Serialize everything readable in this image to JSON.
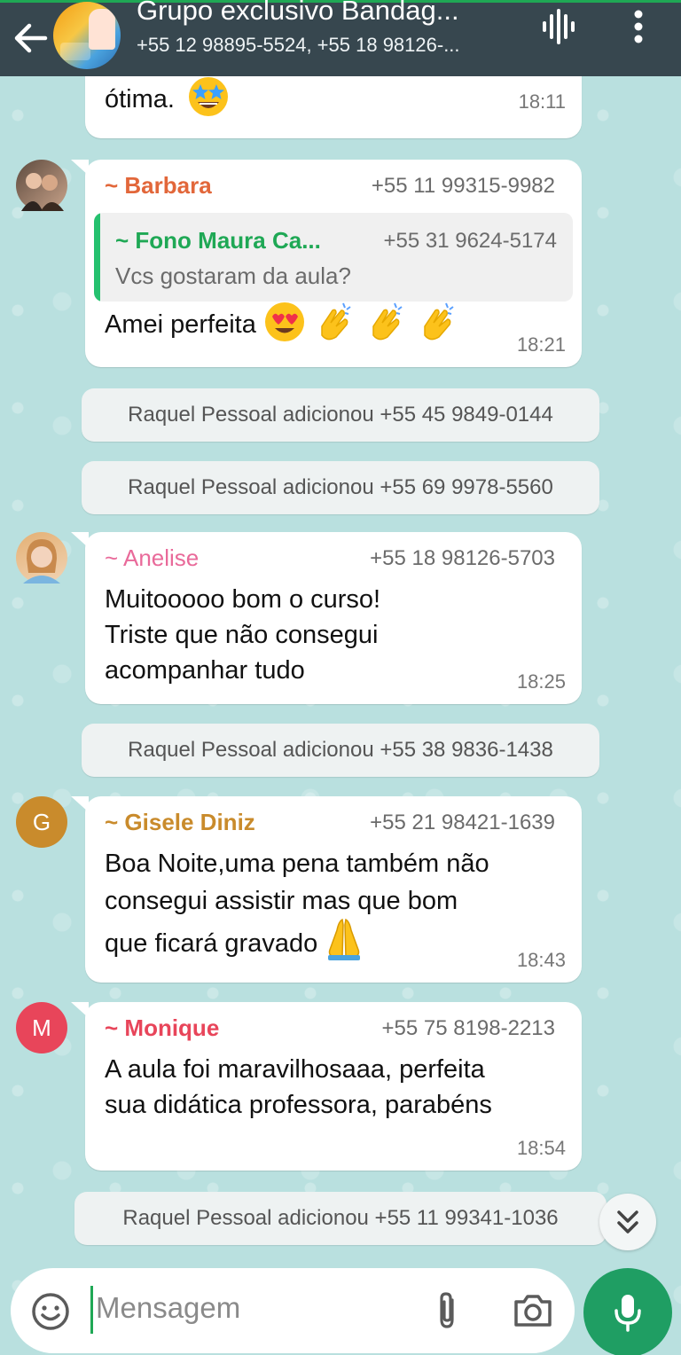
{
  "header": {
    "title": "Grupo exclusivo Bandag...",
    "subtitle": "+55 12 98895-5524, +55 18 98126-..."
  },
  "messages": {
    "m0": {
      "text": "ótima.",
      "time": "18:11"
    },
    "m1": {
      "sender": "~ Barbara",
      "phone": "+55 11 99315-9982",
      "quote_sender": "~ Fono Maura Ca...",
      "quote_phone": "+55 31 9624-5174",
      "quote_text": "Vcs gostaram da aula?",
      "text": "Amei perfeita",
      "time": "18:21"
    },
    "s1": "Raquel Pessoal adicionou +55 45 9849-0144",
    "s2": "Raquel Pessoal adicionou +55 69 9978-5560",
    "m2": {
      "sender": "~ Anelise",
      "phone": "+55 18 98126-5703",
      "line1": "Muitooooo bom o curso!",
      "line2": "Triste que não consegui",
      "line3": "acompanhar tudo",
      "time": "18:25"
    },
    "s3": "Raquel Pessoal adicionou +55 38 9836-1438",
    "m3": {
      "avatar_letter": "G",
      "sender": "~ Gisele Diniz",
      "phone": "+55 21 98421-1639",
      "line1": "Boa Noite,uma pena também não",
      "line2": "consegui assistir mas que bom",
      "line3": "que ficará gravado",
      "time": "18:43"
    },
    "m4": {
      "avatar_letter": "M",
      "sender": "~ Monique",
      "phone": "+55 75 8198-2213",
      "line1": "A aula foi maravilhosaaa, perfeita",
      "line2": "sua didática professora, parabéns",
      "time": "18:54"
    },
    "s4": "Raquel Pessoal adicionou +55 11 99341-1036"
  },
  "composer": {
    "placeholder": "Mensagem"
  },
  "colors": {
    "header": "#37474f",
    "barbara": "#e2673a",
    "anelise": "#e96a9a",
    "gisele": "#c98b2c",
    "monique": "#e8455a",
    "quote": "#1fa855",
    "mic": "#1f9e63"
  },
  "icons": [
    "back-arrow-icon",
    "voice-call-icon",
    "more-vert-icon",
    "star-eyes-emoji",
    "heart-eyes-emoji",
    "clapping-hands-emoji",
    "praying-hands-emoji",
    "chevron-double-down-icon",
    "emoji-icon",
    "attach-icon",
    "camera-icon",
    "mic-icon"
  ]
}
